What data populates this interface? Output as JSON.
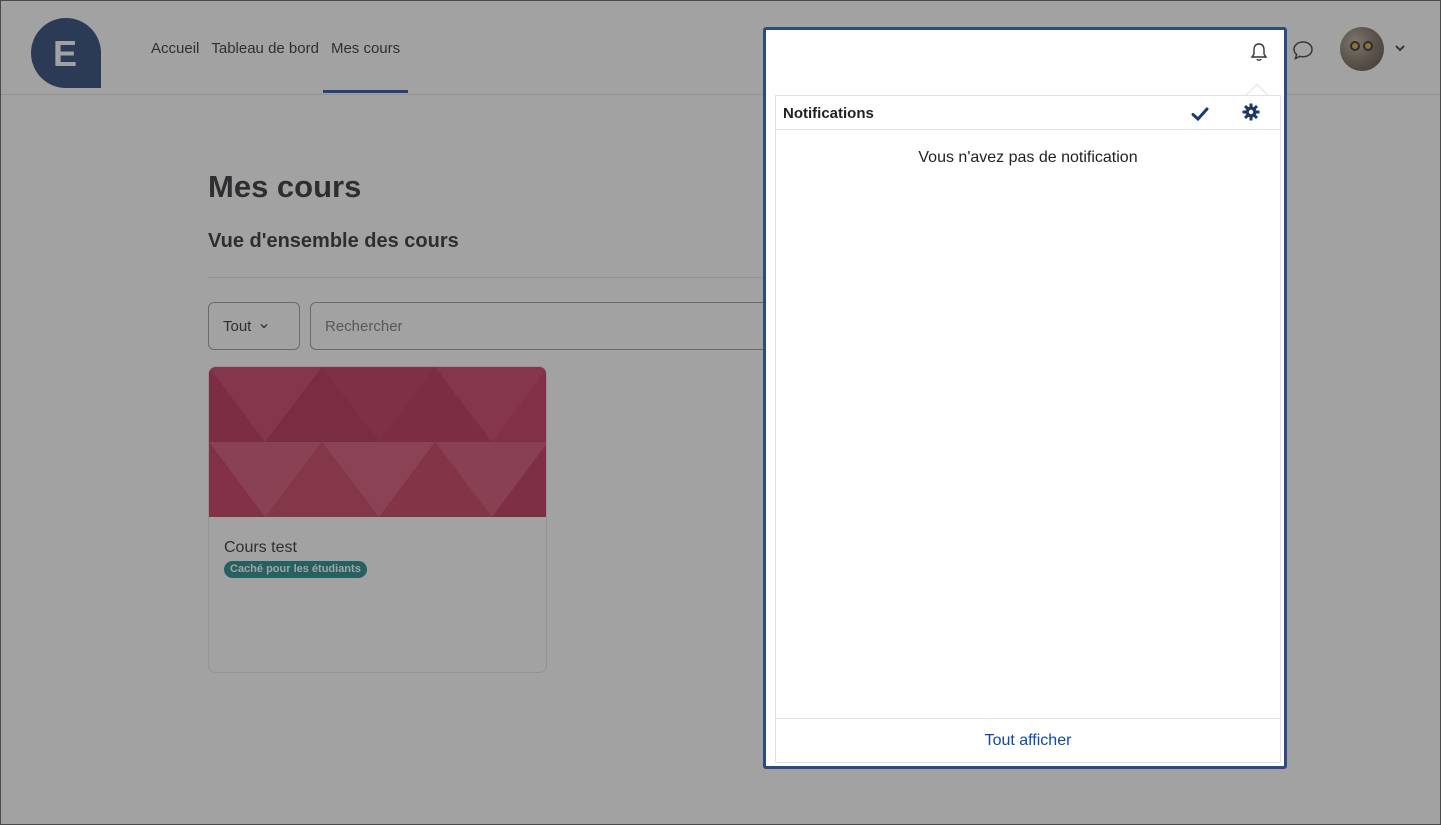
{
  "navbar": {
    "logo_letter": "E",
    "links": [
      {
        "label": "Accueil"
      },
      {
        "label": "Tableau de bord"
      },
      {
        "label": "Mes cours",
        "active": true
      }
    ],
    "icons": [
      "bell-icon",
      "chat-icon",
      "avatar",
      "chevron-down-icon"
    ]
  },
  "main": {
    "title": "Mes cours",
    "section_title": "Vue d'ensemble des cours",
    "filter": {
      "selected": "Tout"
    },
    "search": {
      "placeholder": "Rechercher",
      "value": ""
    },
    "courses": [
      {
        "name": "Cours test",
        "badge": "Caché pour les étudiants"
      }
    ]
  },
  "notifications": {
    "title": "Notifications",
    "empty_message": "Vous n'avez pas de notification",
    "footer_link": "Tout afficher"
  },
  "colors": {
    "brand": "#1b3a6b",
    "accent": "#0f47ad",
    "badge": "#138282",
    "course_image": "#c2264f",
    "popover_outline": "#2a4b86"
  }
}
